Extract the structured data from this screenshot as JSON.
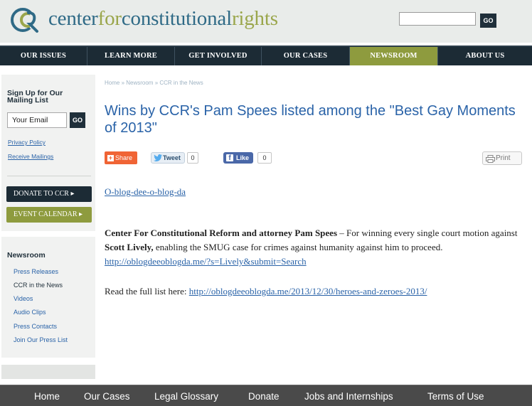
{
  "header": {
    "logo": {
      "part1": "center",
      "part2": "for",
      "part3": "constitutional",
      "part4": "rights"
    },
    "search": {
      "value": "",
      "go_label": "GO"
    }
  },
  "nav": {
    "items": [
      {
        "label": "OUR ISSUES",
        "active": false
      },
      {
        "label": "LEARN MORE",
        "active": false
      },
      {
        "label": "GET INVOLVED",
        "active": false
      },
      {
        "label": "OUR CASES",
        "active": false
      },
      {
        "label": "NEWSROOM",
        "active": true
      },
      {
        "label": "ABOUT US",
        "active": false
      }
    ]
  },
  "sidebar": {
    "signup_title": "Sign Up for Our Mailing List",
    "email_value": "Your Email",
    "email_go": "GO",
    "privacy_link": "Privacy Policy",
    "receive_link": "Receive Mailings",
    "donate_label": "DONATE TO CCR ▸",
    "event_label": "EVENT CALENDAR ▸",
    "newsroom": {
      "title": "Newsroom",
      "items": [
        "Press Releases",
        "CCR in the News",
        "Videos",
        "Audio Clips",
        "Press Contacts",
        "Join Our Press List"
      ],
      "current": "CCR in the News"
    }
  },
  "main": {
    "breadcrumb": "Home » Newsroom » CCR in the News",
    "title": "Wins by CCR's Pam Spees listed among the \"Best Gay Moments of 2013\"",
    "share": {
      "share_label": "Share",
      "tweet_label": "Tweet",
      "tweet_count": "0",
      "like_label": "Like",
      "like_count": "0",
      "print_label": "Print"
    },
    "blog_link": "O-blog-dee-o-blog-da",
    "para1": {
      "bold1": "Center For Constitutional Reform and attorney Pam Spees",
      "text1": " – For winning every single court motion against ",
      "bold2": "Scott Lively,",
      "text2": " enabling the SMUG case for crimes against humanity against him to proceed. ",
      "link": "http://oblogdeeoblogda.me/?s=Lively&submit=Search"
    },
    "para2": {
      "text": "Read the full list here: ",
      "link": "http://oblogdeeoblogda.me/2013/12/30/heroes-and-zeroes-2013/"
    }
  },
  "footer": {
    "items": [
      "Home",
      "Our Cases",
      "Legal Glossary",
      "Donate",
      "Jobs and Internships",
      "Terms of Use"
    ]
  },
  "colors": {
    "brand_blue": "#2f6a86",
    "brand_green": "#9aa64b",
    "nav_dark": "#1c2b35",
    "nav_active": "#8e9b3e",
    "link": "#2a63a8",
    "share_orange": "#f06435",
    "facebook": "#4a68a8",
    "footer": "#4a4a4a"
  }
}
